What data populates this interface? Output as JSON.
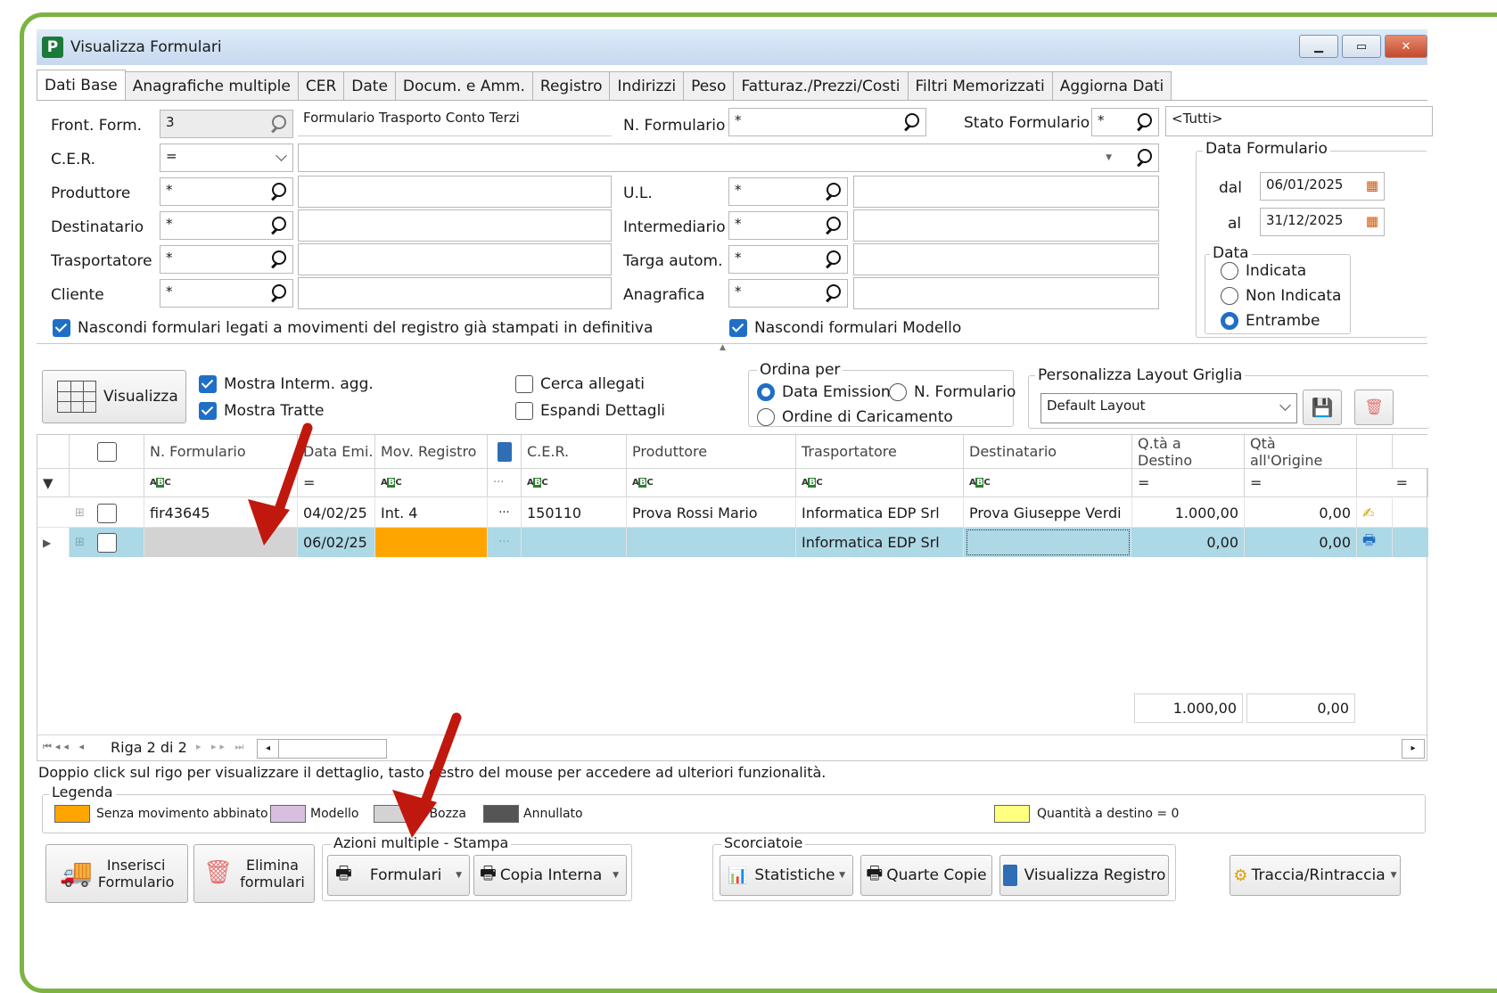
{
  "window": {
    "title": "Visualizza Formulari",
    "app_icon_letter": "P"
  },
  "tabs": [
    "Dati Base",
    "Anagrafiche multiple",
    "CER",
    "Date",
    "Docum. e Amm.",
    "Registro",
    "Indirizzi",
    "Peso",
    "Fatturaz./Prezzi/Costi",
    "Filtri Memorizzati",
    "Aggiorna Dati"
  ],
  "filters": {
    "front_form_label": "Front. Form.",
    "front_form_value": "3",
    "front_form_desc": "Formulario Trasporto Conto Terzi",
    "n_formulario_label": "N. Formulario",
    "n_formulario_value": "*",
    "stato_label": "Stato Formulario",
    "stato_value": "*",
    "stato_desc": "<Tutti>",
    "cer_label": "C.E.R.",
    "cer_op": "=",
    "produttore_label": "Produttore",
    "produttore_value": "*",
    "ul_label": "U.L.",
    "ul_value": "*",
    "destinatario_label": "Destinatario",
    "destinatario_value": "*",
    "intermediario_label": "Intermediario",
    "intermediario_value": "*",
    "trasportatore_label": "Trasportatore",
    "trasportatore_value": "*",
    "targa_label": "Targa autom.",
    "targa_value": "*",
    "cliente_label": "Cliente",
    "cliente_value": "*",
    "anagrafica_label": "Anagrafica",
    "anagrafica_value": "*",
    "nascondi_registro": "Nascondi formulari legati a movimenti del registro già stampati in definitiva",
    "nascondi_modello": "Nascondi formulari Modello"
  },
  "data_formulario": {
    "title": "Data Formulario",
    "dal_label": "dal",
    "dal_value": "06/01/2025",
    "al_label": "al",
    "al_value": "31/12/2025",
    "data_group": "Data",
    "options": [
      "Indicata",
      "Non Indicata",
      "Entrambe"
    ],
    "selected": "Entrambe"
  },
  "toolbar": {
    "visualizza": "Visualizza",
    "mostra_interm": "Mostra Interm. agg.",
    "mostra_tratte": "Mostra Tratte",
    "cerca_allegati": "Cerca allegati",
    "espandi_dettagli": "Espandi Dettagli",
    "ordina_title": "Ordina per",
    "ordina_options": [
      "Data Emissione",
      "N. Formulario",
      "Ordine di Caricamento"
    ],
    "ordina_selected": "Data Emissione",
    "layout_title": "Personalizza Layout Griglia",
    "layout_value": "Default Layout"
  },
  "grid": {
    "headers": [
      "N. Formulario",
      "Data Emi.",
      "Mov. Registro",
      "C.E.R.",
      "Produttore",
      "Trasportatore",
      "Destinatario",
      "Q.tà a Destino",
      "Qtà all'Origine"
    ],
    "filter_eq": "=",
    "filter_dots": "···",
    "rows": [
      {
        "n_formulario": "fir43645",
        "data": "04/02/25",
        "mov": "Int. 4",
        "dots": "···",
        "cer": "150110",
        "produttore": "Prova Rossi Mario",
        "trasportatore": "Informatica EDP Srl",
        "destinatario": "Prova Giuseppe Verdi",
        "q_dest": "1.000,00",
        "q_orig": "0,00"
      },
      {
        "n_formulario": "",
        "data": "06/02/25",
        "mov": "",
        "dots": "···",
        "cer": "",
        "produttore": "",
        "trasportatore": "Informatica EDP Srl",
        "destinatario": "",
        "q_dest": "0,00",
        "q_orig": "0,00"
      }
    ],
    "total_dest": "1.000,00",
    "total_orig": "0,00",
    "nav_text": "Riga 2 di 2"
  },
  "hint": "Doppio click sul rigo per visualizzare il dettaglio, tasto destro del mouse per accedere ad ulteriori funzionalità.",
  "legend": {
    "title": "Legenda",
    "items": [
      {
        "label": "Senza movimento abbinato",
        "color": "#ffa500"
      },
      {
        "label": "Modello",
        "color": "#d8bfe0"
      },
      {
        "label": "In Bozza",
        "color": "#d3d3d3"
      },
      {
        "label": "Annullato",
        "color": "#555555"
      },
      {
        "label": "Quantità a destino = 0",
        "color": "#ffff80"
      }
    ]
  },
  "actions": {
    "inserisci": "Inserisci\nFormulario",
    "elimina": "Elimina\nformulari",
    "stampa_group": "Azioni multiple - Stampa",
    "formulari": "Formulari",
    "copia_interna": "Copia Interna",
    "scorciatoie_group": "Scorciatoie",
    "statistiche": "Statistiche",
    "quarte_copie": "Quarte Copie",
    "visualizza_registro": "Visualizza Registro",
    "traccia": "Traccia/Rintraccia"
  },
  "colors": {
    "selected_row": "#add8e6",
    "orange": "#ffa500",
    "bozza": "#d3d3d3",
    "accent": "#1f6fc6",
    "arrow": "#c0180e"
  }
}
